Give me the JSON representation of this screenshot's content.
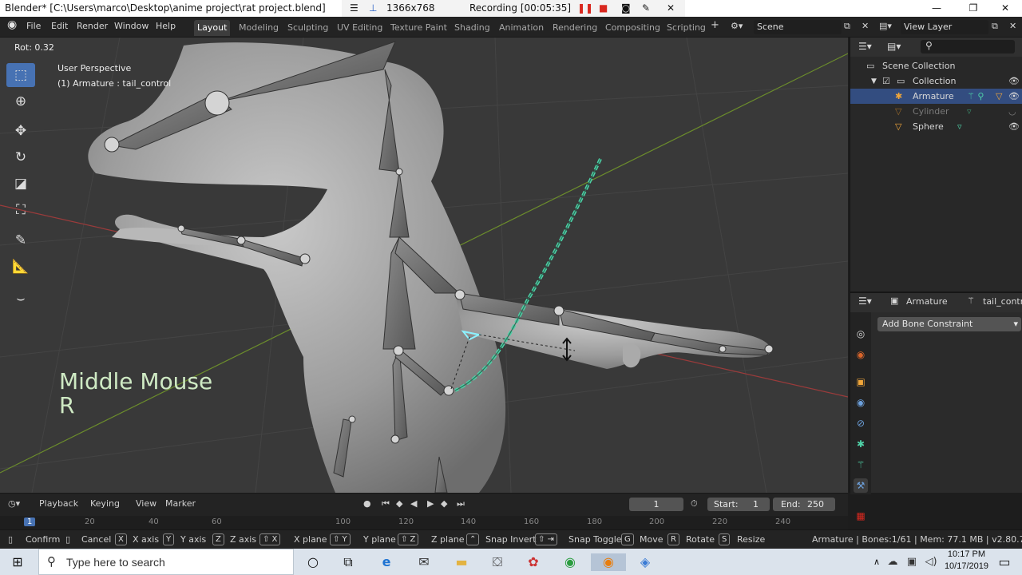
{
  "window": {
    "title": "Blender* [C:\\Users\\marco\\Desktop\\anime project\\rat project.blend]",
    "minimize": "—",
    "maximize": "❐",
    "close": "✕"
  },
  "recorder": {
    "resolution": "1366x768",
    "status": "Recording [00:05:35]"
  },
  "menu": {
    "items": [
      "File",
      "Edit",
      "Render",
      "Window",
      "Help"
    ],
    "workspaces": [
      "Layout",
      "Modeling",
      "Sculpting",
      "UV Editing",
      "Texture Paint",
      "Shading",
      "Animation",
      "Rendering",
      "Compositing",
      "Scripting"
    ],
    "active_workspace": "Layout",
    "scene": "Scene",
    "view_layer": "View Layer"
  },
  "viewport": {
    "header_info": "Rot: 0.32",
    "perspective": "User Perspective",
    "active_object": "(1) Armature : tail_control",
    "overlay_line1": "Middle Mouse",
    "overlay_line2": "R"
  },
  "outliner": {
    "scene_collection": "Scene Collection",
    "collection": "Collection",
    "objects": [
      {
        "name": "Armature",
        "color": "#f0a63a"
      },
      {
        "name": "Cylinder",
        "color": "#7a7a7a"
      },
      {
        "name": "Sphere",
        "color": "#d6d6d6"
      }
    ]
  },
  "properties": {
    "object_name": "Armature",
    "bone_name": "tail_contro",
    "add_constraint": "Add Bone Constraint"
  },
  "timeline": {
    "menus": [
      "Playback",
      "Keying",
      "View",
      "Marker"
    ],
    "current_frame": "1",
    "start_label": "Start:",
    "start": "1",
    "end_label": "End:",
    "end": "250",
    "ruler": [
      "20",
      "40",
      "60",
      "100",
      "120",
      "140",
      "160",
      "180",
      "200",
      "220",
      "240"
    ],
    "ruler_current": "1"
  },
  "statusbar": {
    "confirm": "Confirm",
    "cancel": "Cancel",
    "x_axis": "X axis",
    "y_axis": "Y axis",
    "z_axis": "Z axis",
    "x_plane": "X plane",
    "y_plane": "Y plane",
    "z_plane": "Z plane",
    "snap_invert": "Snap Invert",
    "snap_toggle": "Snap Toggle",
    "move": "Move",
    "rotate": "Rotate",
    "resize": "Resize",
    "info": "Armature | Bones:1/61 | Mem: 77.1 MB | v2.80.75",
    "keys": {
      "x": "X",
      "y": "Y",
      "z": "Z",
      "g": "G",
      "r": "R",
      "s": "S"
    }
  },
  "taskbar": {
    "search_placeholder": "Type here to search",
    "time": "10:17 PM",
    "date": "10/17/2019"
  },
  "colors": {
    "accent": "#4772b3",
    "armature_orange": "#f0a63a",
    "selected_bone": "#4fd2a8",
    "record_red": "#d9281f"
  }
}
